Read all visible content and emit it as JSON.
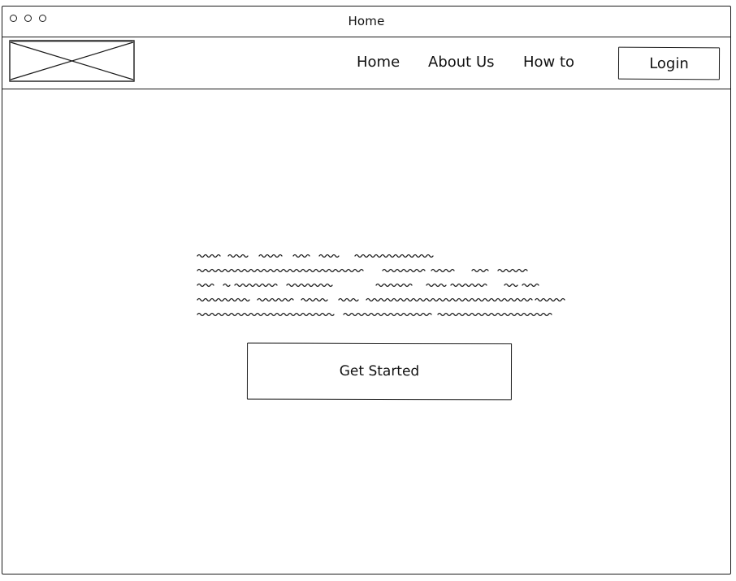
{
  "window": {
    "title": "Home"
  },
  "navbar": {
    "logo_icon": "image-placeholder-icon",
    "links": [
      {
        "label": "Home"
      },
      {
        "label": "About Us"
      },
      {
        "label": "How to"
      }
    ],
    "login_label": "Login"
  },
  "main": {
    "cta_label": "Get Started"
  },
  "colors": {
    "ink": "#1a1a1a",
    "background": "#ffffff"
  }
}
